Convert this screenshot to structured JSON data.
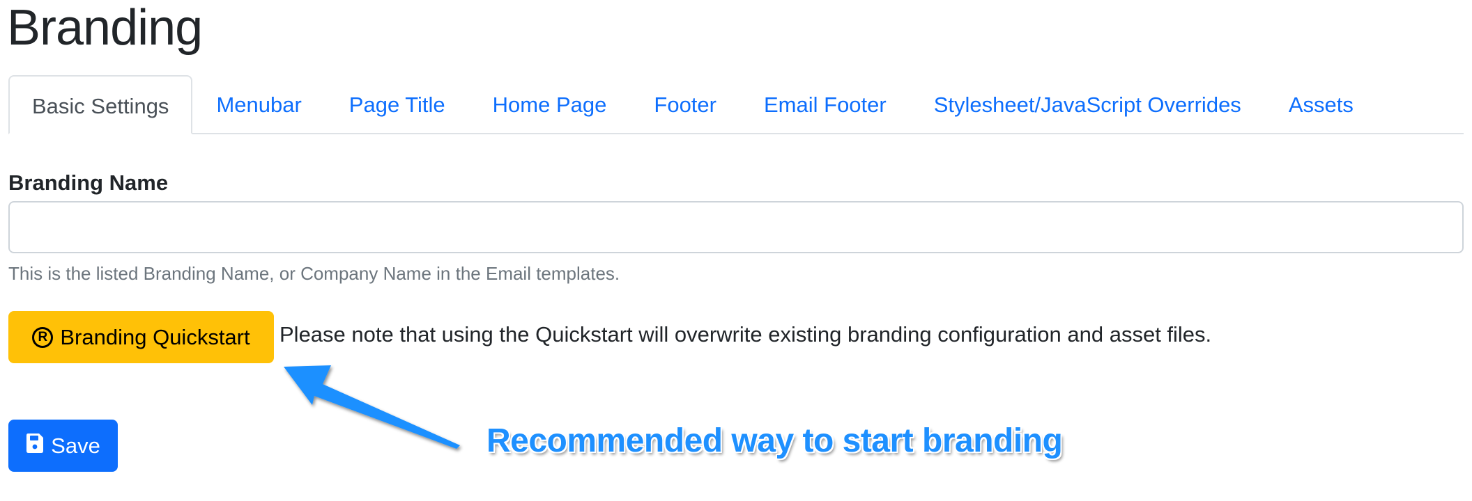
{
  "page": {
    "title": "Branding"
  },
  "tabs": [
    {
      "label": "Basic Settings",
      "active": true
    },
    {
      "label": "Menubar",
      "active": false
    },
    {
      "label": "Page Title",
      "active": false
    },
    {
      "label": "Home Page",
      "active": false
    },
    {
      "label": "Footer",
      "active": false
    },
    {
      "label": "Email Footer",
      "active": false
    },
    {
      "label": "Stylesheet/JavaScript Overrides",
      "active": false
    },
    {
      "label": "Assets",
      "active": false
    }
  ],
  "form": {
    "branding_name_label": "Branding Name",
    "branding_name_value": "",
    "branding_name_placeholder": "",
    "branding_name_help": "This is the listed Branding Name, or Company Name in the Email templates."
  },
  "quickstart": {
    "icon": "registered-icon",
    "icon_glyph": "R",
    "label": "Branding Quickstart",
    "note": "Please note that using the Quickstart will overwrite existing branding configuration and asset files.",
    "color": "#ffc107"
  },
  "save": {
    "icon": "floppy-disk-icon",
    "label": "Save",
    "color": "#0d6efd"
  },
  "annotation": {
    "text": "Recommended way to start branding",
    "color": "#1e90ff"
  },
  "colors": {
    "link": "#0d6efd",
    "active_tab_text": "#495057",
    "muted": "#6c757d",
    "border": "#dee2e6"
  }
}
